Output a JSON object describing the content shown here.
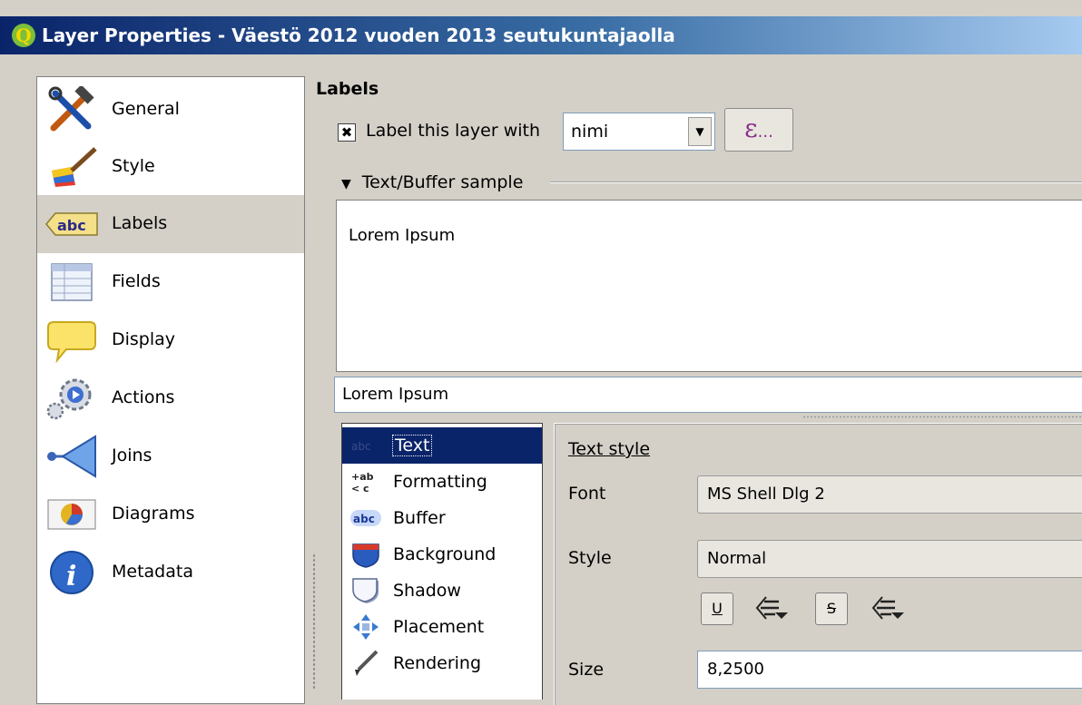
{
  "window": {
    "title": "Layer Properties - Väestö 2012 vuoden 2013 seutukuntajaolla",
    "app_icon_letter": "Q"
  },
  "sidebar": {
    "items": [
      {
        "label": "General",
        "icon": "tools-icon"
      },
      {
        "label": "Style",
        "icon": "paintbrush-icon"
      },
      {
        "label": "Labels",
        "icon": "labels-abc-icon",
        "selected": true
      },
      {
        "label": "Fields",
        "icon": "table-icon"
      },
      {
        "label": "Display",
        "icon": "speech-bubble-icon"
      },
      {
        "label": "Actions",
        "icon": "gears-icon"
      },
      {
        "label": "Joins",
        "icon": "join-arrow-icon"
      },
      {
        "label": "Diagrams",
        "icon": "pie-chart-icon"
      },
      {
        "label": "Metadata",
        "icon": "info-icon"
      }
    ]
  },
  "labels_page": {
    "section_title": "Labels",
    "label_checkbox": {
      "label": "Label this layer with",
      "checked": true,
      "mark": "✖"
    },
    "field_combo": {
      "value": "nimi",
      "arrow": "▼"
    },
    "expression_button": {
      "symbol": "ε",
      "dots": "..."
    },
    "sample_group": {
      "label": "Text/Buffer sample",
      "triangle": "▼"
    },
    "preview_text": "Lorem Ipsum",
    "sample_input_value": "Lorem Ipsum"
  },
  "tabs": [
    {
      "label": "Text",
      "icon": "abc-text-icon",
      "selected": true
    },
    {
      "label": "Formatting",
      "icon": "formatting-icon"
    },
    {
      "label": "Buffer",
      "icon": "abc-buffer-icon"
    },
    {
      "label": "Background",
      "icon": "shield-background-icon"
    },
    {
      "label": "Shadow",
      "icon": "shadow-icon"
    },
    {
      "label": "Placement",
      "icon": "placement-arrows-icon"
    },
    {
      "label": "Rendering",
      "icon": "brush-rendering-icon"
    }
  ],
  "text_style": {
    "title": "Text style",
    "font_label": "Font",
    "font_value": "MS Shell Dlg 2",
    "style_label": "Style",
    "style_value": "Normal",
    "underline_btn": "U",
    "strike_btn": "S",
    "size_label": "Size",
    "size_value": "8,2500"
  },
  "colors": {
    "titlebar_start": "#0a246a",
    "titlebar_end": "#a6caf0",
    "selection": "#0a246a",
    "background": "#d4d0c8"
  }
}
